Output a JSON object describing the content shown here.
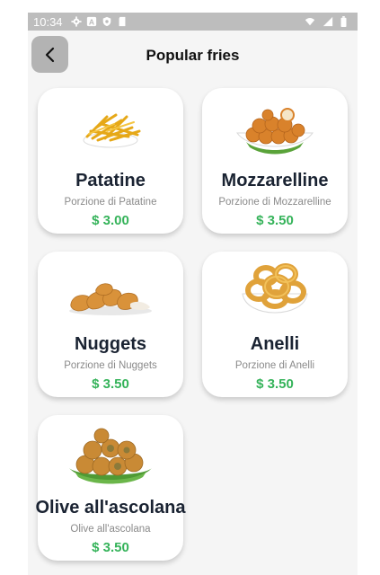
{
  "status_bar": {
    "time": "10:34"
  },
  "header": {
    "title": "Popular fries"
  },
  "products": [
    {
      "name": "Patatine",
      "description": "Porzione di Patatine",
      "price": "$ 3.00",
      "image": "fries-image"
    },
    {
      "name": "Mozzarelline",
      "description": "Porzione di Mozzarelline",
      "price": "$ 3.50",
      "image": "mozzarella-balls-image"
    },
    {
      "name": "Nuggets",
      "description": "Porzione di Nuggets",
      "price": "$ 3.50",
      "image": "chicken-nuggets-image"
    },
    {
      "name": "Anelli",
      "description": "Porzione di Anelli",
      "price": "$ 3.50",
      "image": "onion-rings-image"
    },
    {
      "name": "Olive all'ascolana",
      "description": "Olive all'ascolana",
      "price": "$ 3.50",
      "image": "fried-olives-image"
    }
  ],
  "colors": {
    "price": "#35b35a",
    "name": "#1a2332",
    "back_button": "#b3b3b3",
    "status_bar": "#bdbdbd"
  }
}
